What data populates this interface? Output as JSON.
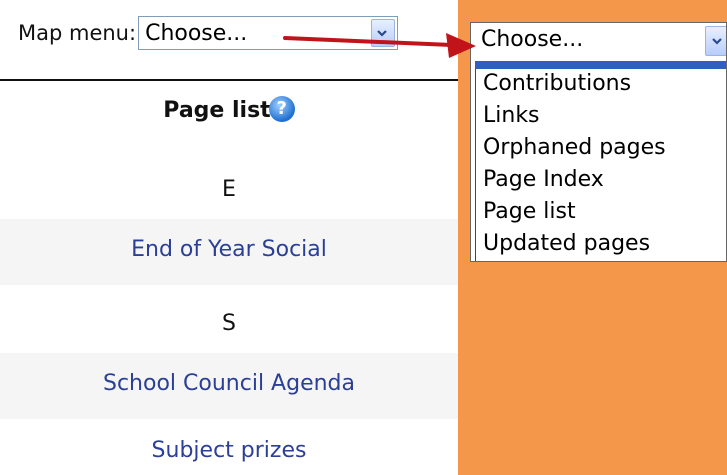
{
  "map_menu": {
    "label": "Map menu:",
    "selected": "Choose..."
  },
  "page_list": {
    "title": "Page list",
    "help_icon_glyph": "?",
    "rows": [
      {
        "type": "letter",
        "text": "E"
      },
      {
        "type": "link",
        "text": "End of Year Social"
      },
      {
        "type": "letter",
        "text": "S"
      },
      {
        "type": "link",
        "text": "School Council Agenda"
      },
      {
        "type": "link",
        "text": "Subject prizes"
      }
    ]
  },
  "dropdown": {
    "selected": "Choose...",
    "options": [
      "Contributions",
      "Links",
      "Orphaned pages",
      "Page Index",
      "Page list",
      "Updated pages"
    ]
  },
  "colors": {
    "panel_background": "#f4974a",
    "arrow": "#c0141a",
    "link": "#2b3f96"
  },
  "icons": {
    "help": "help-question-icon",
    "dropdown_button": "chevron-down-icon",
    "annotation": "red-arrow"
  }
}
